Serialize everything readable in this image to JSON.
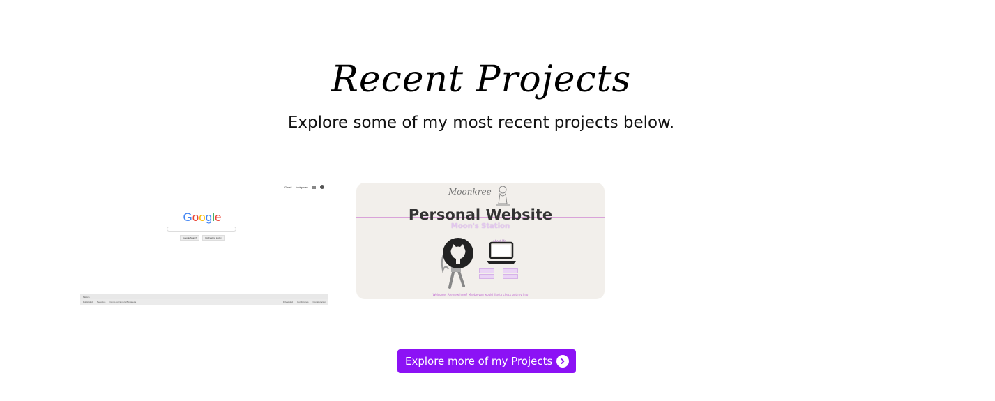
{
  "section": {
    "title": "Recent Projects",
    "subtitle": "Explore some of my most recent projects below."
  },
  "projects": [
    {
      "name": "",
      "preview": {
        "logo_letters": [
          "G",
          "o",
          "o",
          "g",
          "l",
          "e"
        ],
        "logo_colors": [
          "#4285f4",
          "#ea4335",
          "#fbbc05",
          "#4285f4",
          "#34a853",
          "#ea4335"
        ],
        "topbar": [
          "Gmail",
          "Imágenes"
        ],
        "buttons": [
          "Google Search",
          "I'm Feeling Lucky"
        ],
        "footer_country": "México",
        "footer_left": [
          "Publicidad",
          "Negocios",
          "Cómo funciona la Búsqueda"
        ],
        "footer_right": [
          "Privacidad",
          "Condiciones",
          "Configuración"
        ]
      }
    },
    {
      "name": "Personal Website",
      "preview": {
        "brand": "Moonkree",
        "subbrand": "Moon's Station",
        "small_title": "About Me",
        "welcome": "Welcome! Are new here? Maybe you would like to check out my info"
      }
    }
  ],
  "cta": {
    "label": "Explore more of my Projects",
    "icon": "chevron-right-circle-icon",
    "color": "#8c12f5"
  }
}
